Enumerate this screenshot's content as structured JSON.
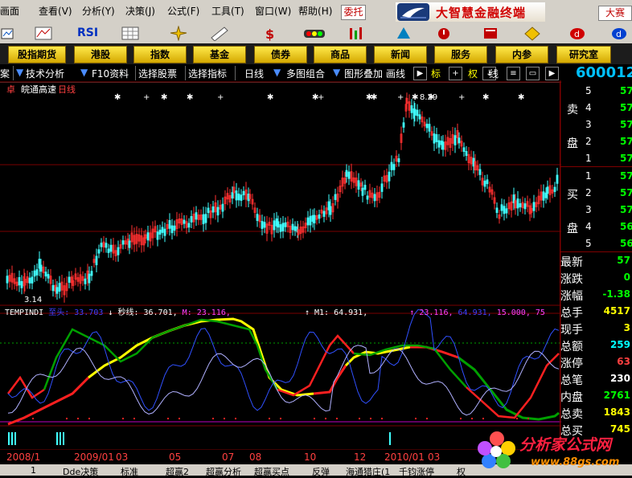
{
  "menu": {
    "items": [
      "画面",
      "查看",
      "分析",
      "决策",
      "公式",
      "工具",
      "窗口",
      "帮助"
    ],
    "accelerators": [
      "",
      "(V)",
      "(Y)",
      "(J)",
      "(F)",
      "(T)",
      "(W)",
      "(H)"
    ],
    "trade_button": "委托",
    "brand_title": "大智慧金融终端",
    "right_button": "大赛"
  },
  "toolbar": {
    "icons": [
      "chart-icon",
      "rsi-icon",
      "grid-icon",
      "target-icon",
      "ruler-icon",
      "money-icon",
      "traffic-light-icon",
      "bars-icon",
      "rocket-icon",
      "alert-icon",
      "book-icon",
      "diamond-icon",
      "red-d-icon",
      "blue-d-icon"
    ],
    "rsi_label": "RSI"
  },
  "nav": {
    "buttons": [
      "股指期货",
      "港股",
      "指数",
      "基金",
      "债券",
      "商品",
      "新闻",
      "服务",
      "内参",
      "研究室"
    ]
  },
  "tabs": {
    "items": [
      "案",
      "技术分析",
      "F10资料",
      "选择股票",
      "选择指标",
      "日线",
      "多图组合",
      "图形叠加",
      "画线",
      "标",
      "权",
      "线",
      "线"
    ],
    "stock_code": "600012"
  },
  "chart": {
    "stock_name": "皖通高速",
    "period": "日线",
    "high_price_label": "8.29",
    "low_price_label": "3.14"
  },
  "indicator": {
    "name": "TEMPINDI",
    "segments": [
      {
        "text": "至头: 33.703",
        "color": "#4040ff"
      },
      {
        "text": "↓ 秒线: 36.701,",
        "color": "#ffffff"
      },
      {
        "text": "M: 23.116,",
        "color": "#ff40ff"
      },
      {
        "text": "↑ M1: 64.931,",
        "color": "#ffffff"
      },
      {
        "text": "↑ 23.116,",
        "color": "#ff40ff"
      },
      {
        "text": "64.931,",
        "color": "#4040ff"
      },
      {
        "text": "15.000,",
        "color": "#ff40ff"
      },
      {
        "text": "75",
        "color": "#ff40ff"
      }
    ]
  },
  "order_book": {
    "sell_label_1": "卖",
    "sell_label_2": "盘",
    "buy_label_1": "买",
    "buy_label_2": "盘",
    "sell_levels": [
      "5",
      "4",
      "3",
      "2",
      "1"
    ],
    "sell_prices": [
      "57",
      "57",
      "57",
      "57",
      "57"
    ],
    "buy_levels": [
      "1",
      "2",
      "3",
      "4",
      "5"
    ],
    "buy_prices": [
      "57",
      "57",
      "57",
      "56",
      "56"
    ]
  },
  "quote": {
    "rows": [
      {
        "label": "最新",
        "value": "57",
        "color": "#00ff00"
      },
      {
        "label": "涨跌",
        "value": "0",
        "color": "#00ff00"
      },
      {
        "label": "涨幅",
        "value": "-1.38",
        "color": "#00ff00"
      },
      {
        "label": "总手",
        "value": "4517",
        "color": "#ffff00"
      },
      {
        "label": "现手",
        "value": "3",
        "color": "#ffff00"
      },
      {
        "label": "总额",
        "value": "259",
        "color": "#00ffff"
      },
      {
        "label": "涨停",
        "value": "63",
        "color": "#ff4040"
      },
      {
        "label": "总笔",
        "value": "230",
        "color": "#ffffff"
      },
      {
        "label": "内盘",
        "value": "2761",
        "color": "#00ff00"
      },
      {
        "label": "总卖",
        "value": "1843",
        "color": "#ffff00"
      },
      {
        "label": "总买",
        "value": "745",
        "color": "#ffff00"
      }
    ]
  },
  "dates": [
    "2008/1",
    "2009/01",
    "03",
    "05",
    "07",
    "08",
    "10",
    "12",
    "2010/01",
    "03"
  ],
  "bottom_tabs": [
    "1",
    "Dde决策",
    "标准",
    "超赢2",
    "超赢分析",
    "超赢买点",
    "反弹",
    "海通猎庄(1",
    "千钧涨停",
    "权"
  ],
  "watermark": {
    "title": "分析家公式网",
    "url": "www.88gs.com"
  },
  "colors": {
    "up": "#ff3030",
    "down": "#40ffff",
    "yellow_line": "#ffff00",
    "green_line": "#00b000",
    "blue_line": "#3050ff",
    "lavender_line": "#b0b0ff",
    "grid": "#7a0000",
    "accent": "#00c0ff"
  }
}
